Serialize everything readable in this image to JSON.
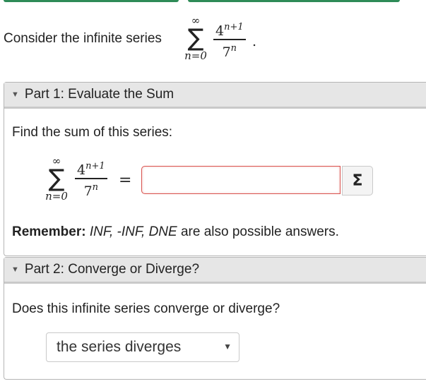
{
  "prompt": {
    "text": "Consider the infinite series",
    "series": {
      "upper": "∞",
      "sigma": "∑",
      "lower": "n=0",
      "numerator_base": "4",
      "numerator_exp": "n+1",
      "denominator_base": "7",
      "denominator_exp": "n"
    },
    "period": "."
  },
  "part1": {
    "header": "Part 1: Evaluate the Sum",
    "question": "Find the sum of this series:",
    "series": {
      "upper": "∞",
      "sigma": "∑",
      "lower": "n=0",
      "numerator_base": "4",
      "numerator_exp": "n+1",
      "denominator_base": "7",
      "denominator_exp": "n"
    },
    "equals": "=",
    "answer_value": "",
    "sigma_button": "Σ",
    "remember_label": "Remember:",
    "remember_answers": "INF, -INF, DNE",
    "remember_rest": " are also possible answers."
  },
  "part2": {
    "header": "Part 2: Converge or Diverge?",
    "question": "Does this infinite series converge or diverge?",
    "select_value": "the series diverges"
  },
  "icons": {
    "caret": "caret-down-icon",
    "select_arrow": "dropdown-arrow-icon"
  }
}
